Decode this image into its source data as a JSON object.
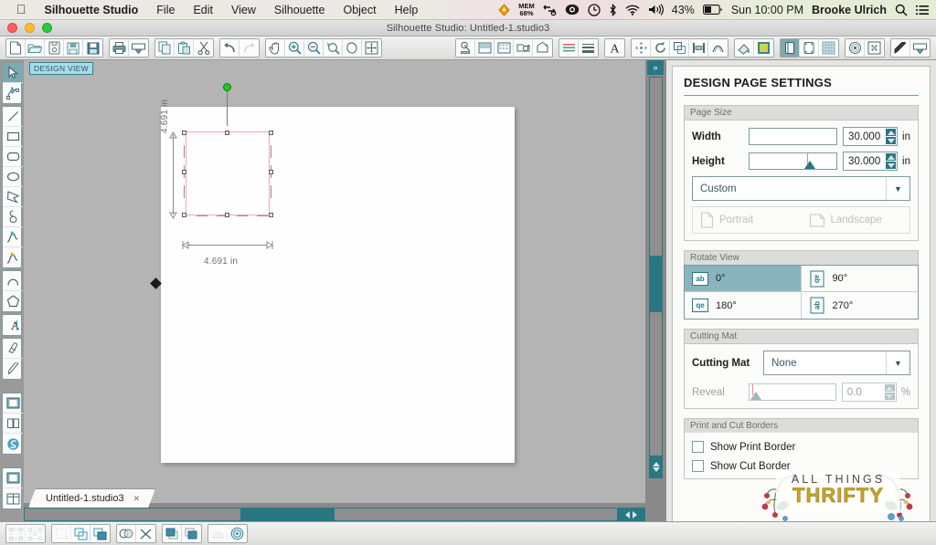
{
  "menubar": {
    "apple_icon": "apple-icon",
    "app_name": "Silhouette Studio",
    "items": [
      "File",
      "Edit",
      "View",
      "Silhouette",
      "Object",
      "Help"
    ],
    "status": {
      "mem_label": "MEM",
      "mem_value": "68%",
      "battery_percent": "43%",
      "clock": "Sun 10:00 PM",
      "user": "Brooke Ulrich",
      "icons": [
        "istat-flame-icon",
        "dropbox-sync-icon",
        "backblaze-icon",
        "time-machine-icon",
        "bluetooth-icon",
        "wifi-icon",
        "volume-icon",
        "battery-icon",
        "spotlight-search-icon",
        "notification-center-icon"
      ]
    }
  },
  "window": {
    "title": "Silhouette Studio: Untitled-1.studio3",
    "traffic_lights": [
      "close-button",
      "minimize-button",
      "zoom-button"
    ]
  },
  "toolbar": {
    "groups": [
      {
        "name": "file-group",
        "buttons": [
          {
            "icon": "new-document-icon",
            "label": "New"
          },
          {
            "icon": "open-folder-icon",
            "label": "Open"
          },
          {
            "icon": "open-recent-icon",
            "label": "Open Recent"
          },
          {
            "icon": "save-icon",
            "label": "Save"
          },
          {
            "icon": "save-as-icon",
            "label": "Save As"
          }
        ]
      },
      {
        "name": "print-group",
        "buttons": [
          {
            "icon": "print-icon",
            "label": "Print"
          },
          {
            "icon": "send-to-silhouette-icon",
            "label": "Send to Silhouette"
          }
        ]
      },
      {
        "name": "clipboard-group",
        "buttons": [
          {
            "icon": "copy-icon",
            "label": "Copy"
          },
          {
            "icon": "paste-icon",
            "label": "Paste"
          },
          {
            "icon": "cut-scissors-icon",
            "label": "Cut"
          }
        ]
      },
      {
        "name": "history-group",
        "buttons": [
          {
            "icon": "undo-arrow-icon",
            "label": "Undo"
          },
          {
            "icon": "redo-arrow-icon",
            "label": "Redo"
          }
        ]
      },
      {
        "name": "view-group",
        "buttons": [
          {
            "icon": "pan-hand-icon",
            "label": "Pan"
          },
          {
            "icon": "zoom-in-icon",
            "label": "Zoom In"
          },
          {
            "icon": "zoom-out-icon",
            "label": "Zoom Out"
          },
          {
            "icon": "zoom-selection-icon",
            "label": "Zoom to Selection"
          },
          {
            "icon": "zoom-fit-icon",
            "label": "Fit to Page"
          },
          {
            "icon": "zoom-all-icon",
            "label": "Fit to Window"
          }
        ]
      },
      {
        "name": "settings-group",
        "buttons": [
          {
            "icon": "design-page-settings-icon",
            "label": "Design Page Settings"
          },
          {
            "icon": "registration-marks-icon",
            "label": "Registration Marks"
          },
          {
            "icon": "cut-settings-icon",
            "label": "Cut Settings"
          },
          {
            "icon": "material-icon",
            "label": "Material Settings"
          },
          {
            "icon": "pen-holder-icon",
            "label": "Pen Holder"
          }
        ]
      },
      {
        "name": "align-group",
        "buttons": [
          {
            "icon": "line-style-icon",
            "label": "Line Style"
          },
          {
            "icon": "line-thickness-icon",
            "label": "Line Thickness"
          }
        ]
      },
      {
        "name": "text-group",
        "buttons": [
          {
            "icon": "text-style-icon",
            "label": "Text Style"
          }
        ]
      },
      {
        "name": "transform-group",
        "buttons": [
          {
            "icon": "move-transform-icon",
            "label": "Move"
          },
          {
            "icon": "rotate-icon",
            "label": "Rotate"
          },
          {
            "icon": "scale-icon",
            "label": "Scale"
          },
          {
            "icon": "align-icon",
            "label": "Align"
          },
          {
            "icon": "replicate-icon",
            "label": "Replicate"
          }
        ]
      },
      {
        "name": "fill-group",
        "buttons": [
          {
            "icon": "fill-color-icon",
            "label": "Fill Color"
          },
          {
            "icon": "gradient-fill-icon",
            "label": "Gradient Fill"
          }
        ]
      },
      {
        "name": "page-group",
        "buttons": [
          {
            "icon": "page-setup-icon",
            "label": "Page Setup"
          },
          {
            "icon": "cutting-mat-icon",
            "label": "Cutting Mat"
          },
          {
            "icon": "grid-icon",
            "label": "Grid"
          }
        ]
      },
      {
        "name": "trace-group",
        "buttons": [
          {
            "icon": "offset-icon",
            "label": "Offset"
          },
          {
            "icon": "trace-icon",
            "label": "Trace"
          }
        ]
      },
      {
        "name": "tool-group",
        "buttons": [
          {
            "icon": "sketch-pen-icon",
            "label": "Sketch Pen"
          },
          {
            "icon": "print-and-cut-icon",
            "label": "Print and Cut"
          }
        ]
      }
    ]
  },
  "left_toolbar": {
    "groups": [
      {
        "name": "select-group",
        "tools": [
          {
            "icon": "select-arrow-icon",
            "label": "Select",
            "active": true
          },
          {
            "icon": "edit-points-icon",
            "label": "Edit Points",
            "active": false
          }
        ]
      },
      {
        "name": "shape-group",
        "tools": [
          {
            "icon": "line-tool-icon",
            "label": "Draw a Line",
            "active": false
          },
          {
            "icon": "rectangle-tool-icon",
            "label": "Draw a Rectangle",
            "active": false
          },
          {
            "icon": "rounded-rectangle-tool-icon",
            "label": "Draw a Rounded Rectangle",
            "active": false
          },
          {
            "icon": "ellipse-tool-icon",
            "label": "Draw an Ellipse",
            "active": false
          },
          {
            "icon": "polygon-tool-icon",
            "label": "Draw a Polygon",
            "active": false
          },
          {
            "icon": "curve-shape-tool-icon",
            "label": "Draw a Curve Shape",
            "active": false
          },
          {
            "icon": "freehand-tool-icon",
            "label": "Draw Freehand",
            "active": false
          },
          {
            "icon": "smooth-freehand-tool-icon",
            "label": "Draw Smooth Freehand",
            "active": false
          }
        ]
      },
      {
        "name": "arc-group",
        "tools": [
          {
            "icon": "arc-tool-icon",
            "label": "Draw an Arc",
            "active": false
          },
          {
            "icon": "regular-polygon-tool-icon",
            "label": "Draw a Regular Polygon",
            "active": false
          }
        ]
      },
      {
        "name": "text-group",
        "tools": [
          {
            "icon": "text-tool-icon",
            "label": "Draw a Text Object",
            "active": false
          }
        ]
      },
      {
        "name": "erase-group",
        "tools": [
          {
            "icon": "eraser-tool-icon",
            "label": "Eraser",
            "active": false
          },
          {
            "icon": "knife-tool-icon",
            "label": "Knife",
            "active": false
          }
        ]
      },
      {
        "name": "panel-group-1",
        "tools": [
          {
            "icon": "design-page-panel-icon",
            "label": "Design Page",
            "active": false
          },
          {
            "icon": "library-panel-icon",
            "label": "Library",
            "active": false
          },
          {
            "icon": "store-panel-icon",
            "label": "Silhouette Design Store",
            "active": false
          }
        ]
      },
      {
        "name": "panel-group-2",
        "tools": [
          {
            "icon": "workspace-view-icon",
            "label": "Workspace View",
            "active": false
          },
          {
            "icon": "split-view-icon",
            "label": "Split View",
            "active": false
          }
        ]
      }
    ]
  },
  "canvas": {
    "view_badge": "DESIGN VIEW",
    "selection": {
      "width_label": "4.691 in",
      "height_label": "4.691 in",
      "rotate_handle": "rotation-handle",
      "shape_stroke_color": "#f2aab0"
    }
  },
  "tab": {
    "name": "Untitled-1.studio3",
    "close_icon": "close-tab-icon"
  },
  "panel": {
    "title": "DESIGN PAGE SETTINGS",
    "page_size": {
      "section_label": "Page Size",
      "width_label": "Width",
      "width_value": "30.000",
      "width_unit": "in",
      "height_label": "Height",
      "height_value": "30.000",
      "height_unit": "in",
      "preset_value": "Custom",
      "preset_arrow": "chevron-down-icon",
      "portrait_label": "Portrait",
      "landscape_label": "Landscape",
      "portrait_icon": "portrait-page-icon",
      "landscape_icon": "landscape-page-icon"
    },
    "rotate_view": {
      "section_label": "Rotate View",
      "options": [
        {
          "label": "0°",
          "glyph": "ab",
          "active": true
        },
        {
          "label": "90°",
          "glyph": "ab",
          "active": false
        },
        {
          "label": "180°",
          "glyph": "qe",
          "active": false
        },
        {
          "label": "270°",
          "glyph": "ab",
          "active": false
        }
      ]
    },
    "cutting_mat": {
      "section_label": "Cutting Mat",
      "label": "Cutting Mat",
      "value": "None",
      "arrow": "chevron-down-icon",
      "reveal_label": "Reveal",
      "reveal_value": "0.0",
      "reveal_unit": "%"
    },
    "borders": {
      "section_label": "Print and Cut Borders",
      "show_print_border": "Show Print Border",
      "show_cut_border": "Show Cut Border"
    }
  },
  "bottom_toolbar": {
    "buttons": [
      {
        "icon": "group-icon",
        "label": "Group"
      },
      {
        "icon": "ungroup-icon",
        "label": "Ungroup"
      },
      {
        "icon": "make-compound-path-icon",
        "label": "Make Compound Path"
      },
      {
        "icon": "release-compound-path-icon",
        "label": "Release Compound Path"
      },
      {
        "icon": "duplicate-icon",
        "label": "Duplicate"
      },
      {
        "icon": "weld-icon",
        "label": "Weld"
      },
      {
        "icon": "detach-icon",
        "label": "Detach"
      },
      {
        "icon": "bring-to-front-icon",
        "label": "Bring to Front"
      },
      {
        "icon": "send-to-back-icon",
        "label": "Send to Back"
      },
      {
        "icon": "offset-shape-icon",
        "label": "Offset"
      },
      {
        "icon": "trace-area-icon",
        "label": "Trace"
      }
    ]
  },
  "scrollbars": {
    "vertical": {
      "collapse_icon": "collapse-panel-icon",
      "up_icon": "scroll-up-icon",
      "down_icon": "scroll-down-icon"
    },
    "horizontal": {
      "left_icon": "scroll-left-icon",
      "right_icon": "scroll-right-icon"
    }
  },
  "watermark": {
    "line1": "ALL THINGS",
    "line2": "THRIFTY"
  }
}
